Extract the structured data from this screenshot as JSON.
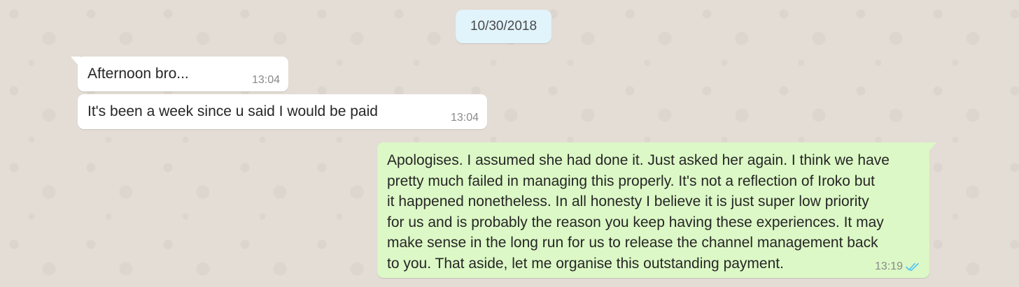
{
  "chat": {
    "date_label": "10/30/2018",
    "messages": [
      {
        "direction": "incoming",
        "text": "Afternoon bro...",
        "time": "13:04"
      },
      {
        "direction": "incoming",
        "text": "It's been a week since u said I would be paid",
        "time": "13:04"
      },
      {
        "direction": "outgoing",
        "lines": [
          "Apologises. I assumed she had done it. Just asked her again. I think we have",
          "pretty much failed in managing this properly. It's not a reflection of Iroko but",
          "it happened nonetheless. In all honesty I believe it is just super low priority",
          "for us and is probably the reason you keep having these experiences. It may",
          "make sense in the long run for us to release the channel management back",
          "to you. That aside, let me organise this outstanding payment."
        ],
        "time": "13:19",
        "status_icon": "double-check-read-icon"
      }
    ]
  },
  "colors": {
    "background": "#e4ddd5",
    "incoming_bubble": "#ffffff",
    "outgoing_bubble": "#dcf8c6",
    "date_chip": "#e1f3fb",
    "read_check": "#4fc3f7"
  }
}
